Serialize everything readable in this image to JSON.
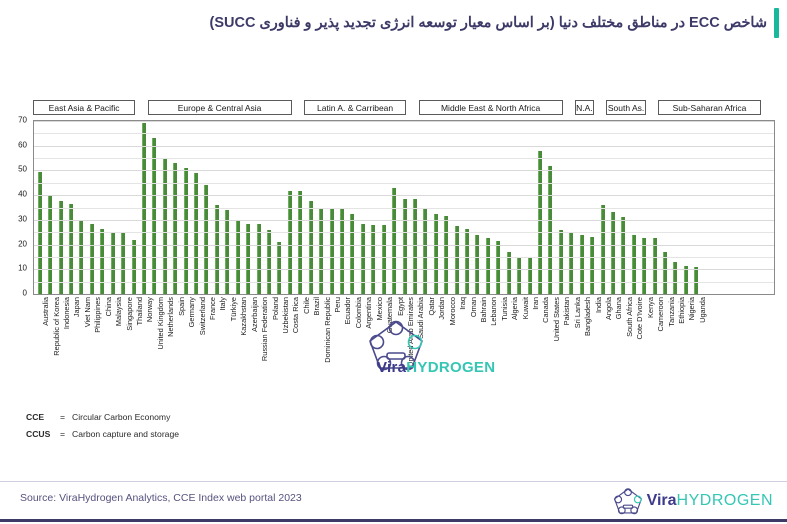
{
  "title": {
    "text": "شاخص CCE در مناطق مختلف دنیا (بر اساس معیار توسعه انرژی تجدید پذیر و فناوری CCUS)",
    "accent_color": "#18b89a",
    "text_color": "#3d3a68"
  },
  "notes": [
    {
      "key": "CCE",
      "eq": "=",
      "value": "Circular Carbon Economy"
    },
    {
      "key": "CCUS",
      "eq": "=",
      "value": "Carbon capture and storage"
    }
  ],
  "footer": {
    "source": "Source: ViraHydrogen Analytics, CCE Index web portal 2023",
    "logo_primary": "Vira",
    "logo_secondary": "HYDROGEN",
    "logo_primary_color": "#3d3a8c",
    "logo_secondary_color": "#35c6b4"
  },
  "watermark": {
    "primary": "Vira",
    "secondary": "HYDROGEN"
  },
  "chart_data": {
    "type": "bar",
    "title": "شاخص CCE در مناطق مختلف دنیا (بر اساس معیار توسعه انرژی تجدید پذیر و فناوری CCUS)",
    "xlabel": "",
    "ylabel": "",
    "ylim": [
      0,
      70
    ],
    "yticks": [
      0,
      10,
      20,
      30,
      40,
      50,
      60,
      70
    ],
    "grid": true,
    "legend": "none",
    "bar_color": "#4a8b3b",
    "regions": [
      {
        "label": "East Asia & Pacific",
        "categories": [
          "Australia",
          "Republic of Korea",
          "Indonesia",
          "Japan",
          "Viet Nam",
          "Philippines",
          "China",
          "Malaysia",
          "Singapore",
          "Thailand"
        ],
        "values": [
          49.5,
          40.0,
          37.5,
          36.5,
          30.0,
          28.5,
          26.5,
          25.0,
          25.0,
          22.0
        ]
      },
      {
        "label": "Europe & Central Asia",
        "categories": [
          "Norway",
          "United Kingdom",
          "Netherlands",
          "Spain",
          "Germany",
          "Switzerland",
          "France",
          "Italy",
          "Türkiye",
          "Kazakhstan",
          "Azerbaijan",
          "Russian Federation",
          "Poland",
          "Uzbekistan"
        ],
        "values": [
          69.0,
          63.0,
          55.0,
          53.0,
          51.0,
          49.0,
          44.0,
          36.0,
          34.0,
          30.0,
          28.5,
          28.5,
          26.0,
          21.0
        ]
      },
      {
        "label": "Latin A. & Carribean",
        "categories": [
          "Costa Rica",
          "Chile",
          "Brazil",
          "Dominican Republic",
          "Peru",
          "Ecuador",
          "Colombia",
          "Argentina",
          "Mexico",
          "Guatemala"
        ],
        "values": [
          41.5,
          41.5,
          37.5,
          35.0,
          34.5,
          34.5,
          32.5,
          28.5,
          28.0,
          28.0
        ]
      },
      {
        "label": "Middle East & North Africa",
        "categories": [
          "Egypt",
          "United Arab Emirates",
          "Saudi Arabia",
          "Qatar",
          "Jordan",
          "Morocco",
          "Iraq",
          "Oman",
          "Bahrain",
          "Lebanon",
          "Tunisia",
          "Algeria",
          "Kuwait",
          "Iran"
        ],
        "values": [
          43.0,
          38.5,
          38.5,
          34.5,
          32.5,
          31.5,
          27.5,
          26.5,
          24.0,
          22.5,
          21.5,
          17.0,
          15.0,
          15.0
        ]
      },
      {
        "label": "N.A.",
        "categories": [
          "Canada",
          "United States"
        ],
        "values": [
          58.0,
          52.0
        ]
      },
      {
        "label": "South As.",
        "categories": [
          "Pakistan",
          "Sri Lanka",
          "Bangladesh",
          "India"
        ],
        "values": [
          26.0,
          25.0,
          24.0,
          23.0
        ]
      },
      {
        "label": "Sub-Saharan Africa",
        "categories": [
          "Angola",
          "Ghana",
          "South Africa",
          "Cote D'Ivoire",
          "Kenya",
          "Cameroon",
          "Tanzania",
          "Ethiopia",
          "Nigeria",
          "Uganda"
        ],
        "values": [
          36.0,
          33.0,
          31.0,
          24.0,
          22.5,
          22.5,
          17.0,
          13.0,
          11.5,
          11.0
        ]
      }
    ]
  }
}
